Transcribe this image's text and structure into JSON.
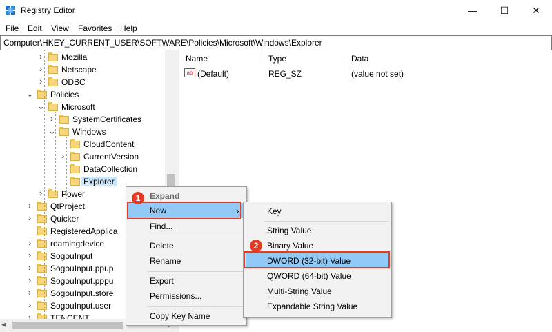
{
  "window": {
    "title": "Registry Editor",
    "minimize": "—",
    "maximize": "☐",
    "close": "✕"
  },
  "menubar": [
    "File",
    "Edit",
    "View",
    "Favorites",
    "Help"
  ],
  "address": "Computer\\HKEY_CURRENT_USER\\SOFTWARE\\Policies\\Microsoft\\Windows\\Explorer",
  "tree": [
    {
      "label": "Mozilla",
      "chevron": ">"
    },
    {
      "label": "Netscape",
      "chevron": ">"
    },
    {
      "label": "ODBC",
      "chevron": ">"
    },
    {
      "label": "Policies",
      "chevron": "v"
    },
    {
      "label": "Microsoft",
      "chevron": "v"
    },
    {
      "label": "SystemCertificates",
      "chevron": ">"
    },
    {
      "label": "Windows",
      "chevron": "v"
    },
    {
      "label": "CloudContent",
      "chevron": ""
    },
    {
      "label": "CurrentVersion",
      "chevron": ">"
    },
    {
      "label": "DataCollection",
      "chevron": ""
    },
    {
      "label": "Explorer",
      "chevron": ""
    },
    {
      "label": "Power",
      "chevron": ">"
    },
    {
      "label": "QtProject",
      "chevron": ">"
    },
    {
      "label": "Quicker",
      "chevron": ">"
    },
    {
      "label": "RegisteredApplica",
      "chevron": ""
    },
    {
      "label": "roamingdevice",
      "chevron": ">"
    },
    {
      "label": "SogouInput",
      "chevron": ">"
    },
    {
      "label": "SogouInput.ppup",
      "chevron": ">"
    },
    {
      "label": "SogouInput.pppu",
      "chevron": ">"
    },
    {
      "label": "SogouInput.store",
      "chevron": ">"
    },
    {
      "label": "SogouInput.user",
      "chevron": ">"
    },
    {
      "label": "TENCENT",
      "chevron": ">"
    }
  ],
  "list": {
    "headers": {
      "name": "Name",
      "type": "Type",
      "data": "Data"
    },
    "rows": [
      {
        "name": "(Default)",
        "type": "REG_SZ",
        "data": "(value not set)",
        "icon": "ab"
      }
    ]
  },
  "context_menu": {
    "items": [
      "Expand",
      "New",
      "Find...",
      "Delete",
      "Rename",
      "Export",
      "Permissions...",
      "Copy Key Name"
    ],
    "submenu_arrow": "›"
  },
  "submenu": {
    "items": [
      "Key",
      "String Value",
      "Binary Value",
      "DWORD (32-bit) Value",
      "QWORD (64-bit) Value",
      "Multi-String Value",
      "Expandable String Value"
    ]
  },
  "badges": [
    "1",
    "2"
  ],
  "colors": {
    "highlight": "#91c9f7",
    "annotation": "#e53b24",
    "folder": "#f5d67b"
  }
}
